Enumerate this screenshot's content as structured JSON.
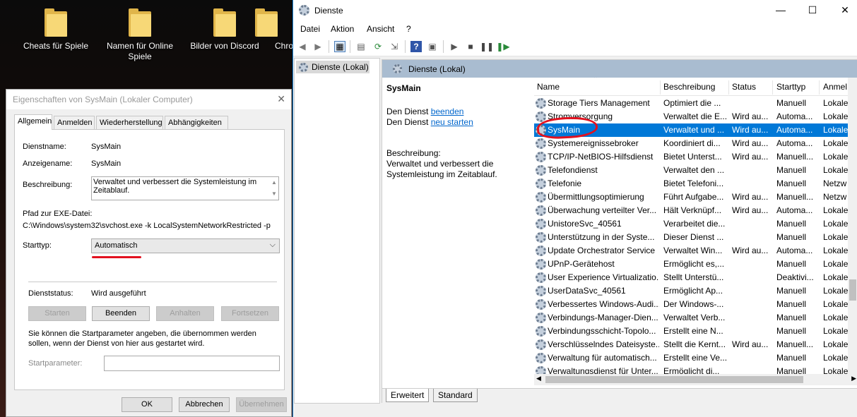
{
  "desktop": {
    "icons": [
      {
        "label": "Cheats für Spiele"
      },
      {
        "label": "Namen für Online Spiele"
      },
      {
        "label": "Bilder von Discord"
      },
      {
        "label": "Chro"
      }
    ]
  },
  "props_dialog": {
    "title": "Eigenschaften von SysMain (Lokaler Computer)",
    "close": "✕",
    "tabs": [
      "Allgemein",
      "Anmelden",
      "Wiederherstellung",
      "Abhängigkeiten"
    ],
    "service_name_label": "Dienstname:",
    "service_name": "SysMain",
    "display_name_label": "Anzeigename:",
    "display_name": "SysMain",
    "description_label": "Beschreibung:",
    "description": "Verwaltet und verbessert die Systemleistung im Zeitablauf.",
    "exe_path_label": "Pfad zur EXE-Datei:",
    "exe_path": "C:\\Windows\\system32\\svchost.exe -k LocalSystemNetworkRestricted -p",
    "startup_type_label": "Starttyp:",
    "startup_type": "Automatisch",
    "status_label": "Dienststatus:",
    "status": "Wird ausgeführt",
    "btn_start": "Starten",
    "btn_stop": "Beenden",
    "btn_pause": "Anhalten",
    "btn_resume": "Fortsetzen",
    "param_hint": "Sie können die Startparameter angeben, die übernommen werden sollen, wenn der Dienst von hier aus gestartet wird.",
    "param_label": "Startparameter:",
    "btn_ok": "OK",
    "btn_cancel": "Abbrechen",
    "btn_apply": "Übernehmen"
  },
  "services": {
    "title": "Dienste",
    "window_controls": {
      "minimize": "—",
      "maximize": "☐",
      "close": "✕"
    },
    "menu": [
      "Datei",
      "Aktion",
      "Ansicht",
      "?"
    ],
    "tree_item": "Dienste (Lokal)",
    "header": "Dienste (Lokal)",
    "ext": {
      "name": "SysMain",
      "line1_prefix": "Den Dienst ",
      "line1_link": "beenden",
      "line2_prefix": "Den Dienst ",
      "line2_link": "neu starten",
      "desc_label": "Beschreibung:",
      "desc": "Verwaltet und verbessert die Systemleistung im Zeitablauf."
    },
    "columns": [
      "Name",
      "Beschreibung",
      "Status",
      "Starttyp",
      "Anmel"
    ],
    "rows": [
      [
        "Storage Tiers Management",
        "Optimiert die ...",
        "",
        "Manuell",
        "Lokale"
      ],
      [
        "Stromversorgung",
        "Verwaltet die E...",
        "Wird au...",
        "Automa...",
        "Lokale"
      ],
      [
        "SysMain",
        "Verwaltet und ...",
        "Wird au...",
        "Automa...",
        "Lokale"
      ],
      [
        "Systemereignissebroker",
        "Koordiniert di...",
        "Wird au...",
        "Automa...",
        "Lokale"
      ],
      [
        "TCP/IP-NetBIOS-Hilfsdienst",
        "Bietet Unterst...",
        "Wird au...",
        "Manuell...",
        "Lokale"
      ],
      [
        "Telefondienst",
        "Verwaltet den ...",
        "",
        "Manuell",
        "Lokale"
      ],
      [
        "Telefonie",
        "Bietet Telefoni...",
        "",
        "Manuell",
        "Netzw"
      ],
      [
        "Übermittlungsoptimierung",
        "Führt Aufgabe...",
        "Wird au...",
        "Manuell...",
        "Netzw"
      ],
      [
        "Überwachung verteilter Ver...",
        "Hält Verknüpf...",
        "Wird au...",
        "Automa...",
        "Lokale"
      ],
      [
        "UnistoreSvc_40561",
        "Verarbeitet die...",
        "",
        "Manuell",
        "Lokale"
      ],
      [
        "Unterstützung in der Syste...",
        "Dieser Dienst ...",
        "",
        "Manuell",
        "Lokale"
      ],
      [
        "Update Orchestrator Service",
        "Verwaltet Win...",
        "Wird au...",
        "Automa...",
        "Lokale"
      ],
      [
        "UPnP-Gerätehost",
        "Ermöglicht es,...",
        "",
        "Manuell",
        "Lokale"
      ],
      [
        "User Experience Virtualizatio...",
        "Stellt Unterstü...",
        "",
        "Deaktivi...",
        "Lokale"
      ],
      [
        "UserDataSvc_40561",
        "Ermöglicht Ap...",
        "",
        "Manuell",
        "Lokale"
      ],
      [
        "Verbessertes Windows-Audi...",
        "Der Windows-...",
        "",
        "Manuell",
        "Lokale"
      ],
      [
        "Verbindungs-Manager-Dien...",
        "Verwaltet Verb...",
        "",
        "Manuell",
        "Lokale"
      ],
      [
        "Verbindungsschicht-Topolo...",
        "Erstellt eine N...",
        "",
        "Manuell",
        "Lokale"
      ],
      [
        "Verschlüsselndes Dateisyste...",
        "Stellt die Kernt...",
        "Wird au...",
        "Manuell...",
        "Lokale"
      ],
      [
        "Verwaltung für automatisch...",
        "Erstellt eine Ve...",
        "",
        "Manuell",
        "Lokale"
      ],
      [
        "Verwaltungsdienst für Unter...",
        "Ermöglicht di...",
        "",
        "Manuell",
        "Lokale"
      ]
    ],
    "bottom_tabs": [
      "Erweitert",
      "Standard"
    ]
  }
}
